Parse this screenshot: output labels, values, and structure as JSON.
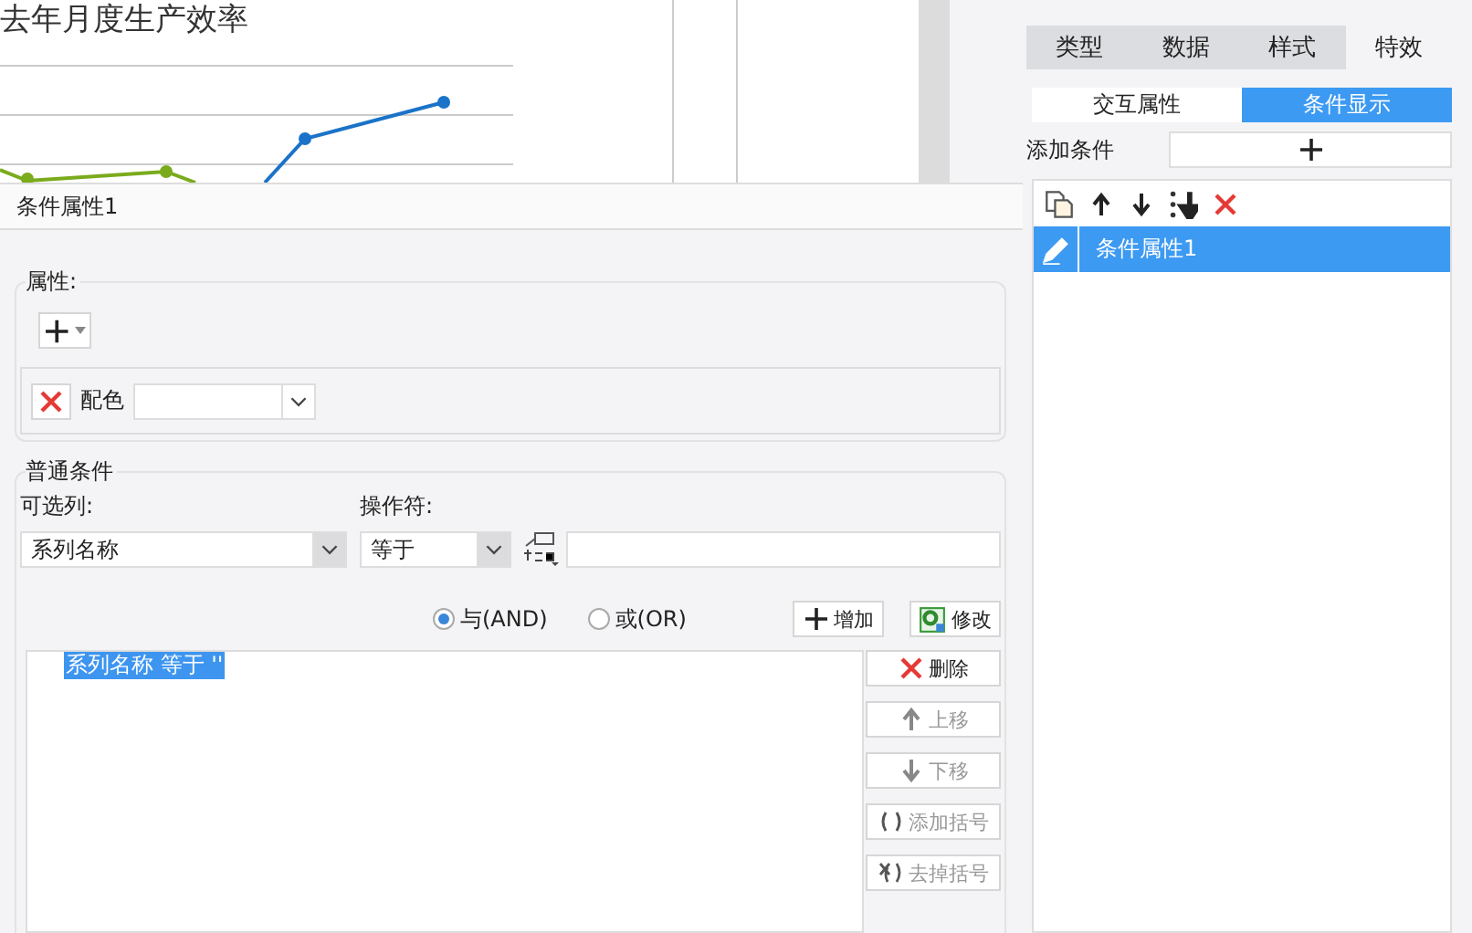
{
  "chart_window": {
    "title": "去年月度生产效率"
  },
  "dialog": {
    "title": "条件属性1",
    "attributes": {
      "legend": "属性:",
      "items": [
        {
          "label": "配色"
        }
      ]
    },
    "conditions": {
      "legend": "普通条件",
      "column_label": "可选列:",
      "column_value": "系列名称",
      "operator_label": "操作符:",
      "operator_value": "等于",
      "logic": [
        {
          "label": "与(AND)",
          "selected": true
        },
        {
          "label": "或(OR)",
          "selected": false
        }
      ],
      "actions": [
        {
          "label": "增加",
          "kind": "plus"
        },
        {
          "label": "修改",
          "kind": "edit"
        }
      ],
      "tree": [
        {
          "text": "系列名称 等于 ''",
          "selected": true
        }
      ],
      "side_buttons": [
        {
          "label": "删除",
          "kind": "delete",
          "disabled": false
        },
        {
          "label": "上移",
          "kind": "up",
          "disabled": true
        },
        {
          "label": "下移",
          "kind": "down",
          "disabled": true
        },
        {
          "label": "添加括号",
          "kind": "paren",
          "disabled": true
        },
        {
          "label": "去掉括号",
          "kind": "unparen",
          "disabled": true
        }
      ]
    }
  },
  "panel": {
    "tabs": [
      {
        "label": "类型",
        "selected": false
      },
      {
        "label": "数据",
        "selected": false
      },
      {
        "label": "样式",
        "selected": false
      },
      {
        "label": "特效",
        "selected": true
      }
    ],
    "subtabs": [
      {
        "label": "交互属性",
        "selected": false
      },
      {
        "label": "条件显示",
        "selected": true
      }
    ],
    "add_label": "添加条件",
    "list": [
      {
        "text": "条件属性1",
        "selected": true
      }
    ]
  }
}
